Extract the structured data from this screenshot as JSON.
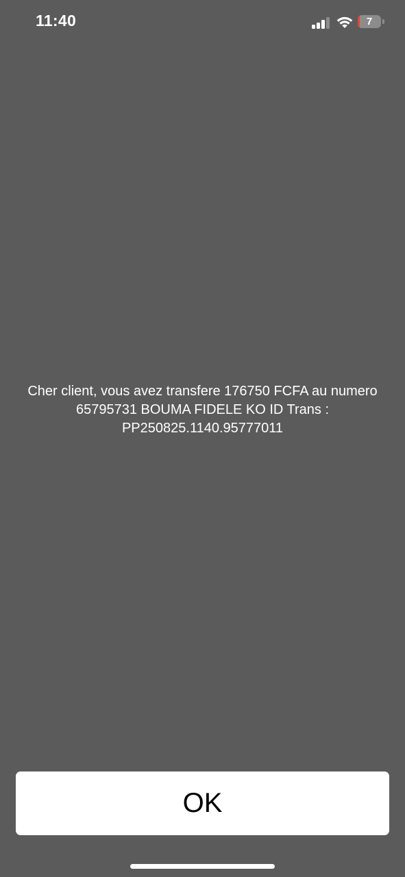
{
  "status_bar": {
    "time": "11:40",
    "battery_level": "7",
    "battery_percent": 7
  },
  "dialog": {
    "message": "Cher client, vous avez transfere 176750 FCFA au numero\n65795731 BOUMA FIDELE KO  ID Trans :\nPP250825.1140.95777011",
    "ok_label": "OK"
  },
  "colors": {
    "background": "#5b5b5b",
    "text": "#ffffff",
    "button": "#ffffff",
    "button_text": "#000000",
    "battery_low": "#ff3b30"
  },
  "icons": [
    "signal-icon",
    "wifi-icon",
    "battery-icon"
  ]
}
